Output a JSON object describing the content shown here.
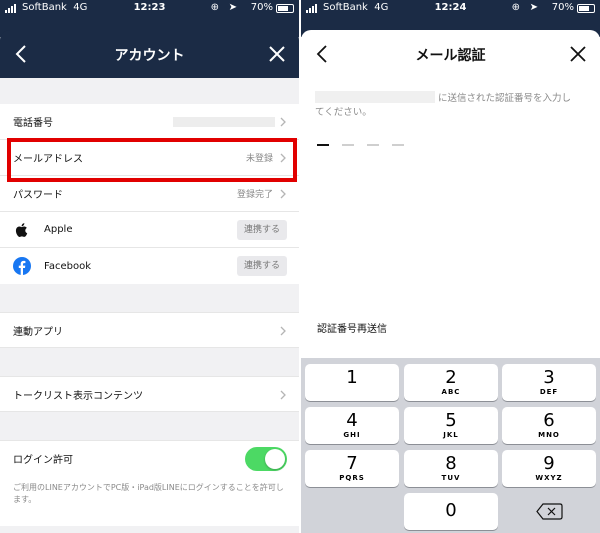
{
  "left": {
    "status": {
      "carrier": "SoftBank",
      "network": "4G",
      "time": "12:23",
      "battery": "70%"
    },
    "header": {
      "title": "アカウント"
    },
    "section1": {
      "rows": [
        {
          "label": "電話番号",
          "value": ""
        },
        {
          "label": "メールアドレス",
          "value": "未登録"
        },
        {
          "label": "パスワード",
          "value": "登録完了"
        },
        {
          "label": "Apple",
          "button": "連携する"
        },
        {
          "label": "Facebook",
          "button": "連携する"
        }
      ]
    },
    "linked_apps": {
      "label": "連動アプリ"
    },
    "talk_list": {
      "label": "トークリスト表示コンテンツ"
    },
    "login": {
      "label": "ログイン許可",
      "enabled": true,
      "note": "ご利用のLINEアカウントでPC版・iPad版LINEにログインすることを許可します。"
    }
  },
  "right": {
    "status": {
      "carrier": "SoftBank",
      "network": "4G",
      "time": "12:24",
      "battery": "70%"
    },
    "header": {
      "title": "メール認証"
    },
    "instruction_part1": "に送信された認証番号を入力し",
    "instruction_part2": "てください。",
    "resend_label": "認証番号再送信",
    "keypad": [
      {
        "num": "1",
        "letters": ""
      },
      {
        "num": "2",
        "letters": "ABC"
      },
      {
        "num": "3",
        "letters": "DEF"
      },
      {
        "num": "4",
        "letters": "GHI"
      },
      {
        "num": "5",
        "letters": "JKL"
      },
      {
        "num": "6",
        "letters": "MNO"
      },
      {
        "num": "7",
        "letters": "PQRS"
      },
      {
        "num": "8",
        "letters": "TUV"
      },
      {
        "num": "9",
        "letters": "WXYZ"
      },
      {
        "num": "0",
        "letters": ""
      }
    ]
  },
  "colors": {
    "navy": "#1b2b45",
    "highlight": "#e10000",
    "toggle_on": "#4cd964"
  }
}
